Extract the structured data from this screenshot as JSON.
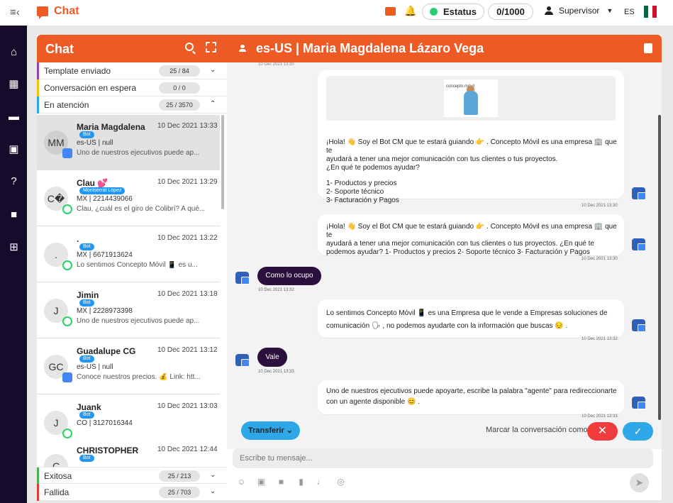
{
  "topbar": {
    "title": "Chat",
    "status_label": "Estatus",
    "counter": "0/1000",
    "user": "Supervisor",
    "lang": "ES",
    "icons": [
      "menu-collapse-icon",
      "chat-icon",
      "bell-icon",
      "user-icon",
      "mexico-flag-icon"
    ]
  },
  "sidebar": {
    "icons": [
      "home-icon",
      "table-icon",
      "chat-icon",
      "badge-icon",
      "help-icon",
      "video-icon",
      "add-box-icon"
    ]
  },
  "list": {
    "title": "Chat",
    "categories": [
      {
        "label": "Template enviado",
        "count": "25 / 84",
        "color": "#8e44ad"
      },
      {
        "label": "Conversación en espera",
        "count": "0 / 0",
        "color": "#f1c40f"
      },
      {
        "label": "En atención",
        "count": "25 / 3570",
        "color": "#2ea7e8"
      },
      {
        "label": "Exitosa",
        "count": "25 / 213",
        "color": "#4caf50"
      },
      {
        "label": "Fallida",
        "count": "25 / 703",
        "color": "#e53935"
      }
    ],
    "conversations": [
      {
        "initials": "MM",
        "name": "Maria Magdalena ...",
        "time": "10 Dec 2021 13:33",
        "tag": "Bot",
        "sub": "es-US | null",
        "preview": "Uno de nuestros ejecutivos puede ap...",
        "channel": "gb"
      },
      {
        "initials": "C�",
        "name": "Clau 💕",
        "time": "10 Dec 2021 13:29",
        "tag": "Montserrat Lopez",
        "sub": "MX | 2214439066",
        "preview": "Clau, ¿cuál es el giro de Colibrí? A qué...",
        "channel": "wa"
      },
      {
        "initials": ".",
        "name": ".",
        "time": "10 Dec 2021 13:22",
        "tag": "Bot",
        "sub": "MX | 6671913624",
        "preview": "Lo sentimos Concepto Móvil 📱 es u...",
        "channel": "wa"
      },
      {
        "initials": "J",
        "name": "Jimin",
        "time": "10 Dec 2021 13:18",
        "tag": "Bot",
        "sub": "MX | 2228973398",
        "preview": "Uno de nuestros ejecutivos puede ap...",
        "channel": "wa"
      },
      {
        "initials": "GC",
        "name": "Guadalupe CG",
        "time": "10 Dec 2021 13:12",
        "tag": "Bot",
        "sub": "es-US | null",
        "preview": "Conoce nuestros precios. 💰 Link: htt...",
        "channel": "gb"
      },
      {
        "initials": "J",
        "name": "Juank",
        "time": "10 Dec 2021 13:03",
        "tag": "Bot",
        "sub": "CO | 3127016344",
        "preview": "",
        "channel": "wa"
      },
      {
        "initials": "C",
        "name": "CHRISTOPHER",
        "time": "10 Dec 2021 12:44",
        "tag": "Bot",
        "sub": "",
        "preview": "",
        "channel": ""
      }
    ]
  },
  "conversation": {
    "title": "es-US | Maria Magdalena Lázaro Vega",
    "top_ts": "10 Dec 2021 13:30",
    "promo_logo": "concepto móvil",
    "msg1": {
      "l1": "¡Hola! 👋 Soy el Bot CM que te estará guiando 👉 . Concepto Móvil es una empresa 🏢 que te",
      "l2": "ayudará a tener una mejor comunicación con tus clientes o tus proyectos.",
      "l3": "¿En qué te podemos ayudar?",
      "l4": "1- Productos y precios",
      "l5": "2- Soporte técnico",
      "l6": "3- Facturación y Pagos",
      "ts": "10 Dec 2021 13:30"
    },
    "msg2": {
      "l1": "¡Hola! 👋 Soy el Bot CM que te estará guiando 👉 . Concepto Móvil es una empresa 🏢 que te",
      "l2": "ayudará a tener una mejor comunicación con tus clientes o tus proyectos. ¿En qué te",
      "l3": "podemos ayudar? 1- Productos y precios 2- Soporte técnico 3- Facturación y Pagos",
      "ts": "10 Dec 2021 13:30"
    },
    "user1": {
      "text": "Como lo ocupo",
      "ts": "10 Dec 2021 13:32"
    },
    "msg3": {
      "l1": "Lo sentimos Concepto Móvil 📱 es una Empresa que le vende a Empresas soluciones de",
      "l2": "comunicación 🗣 , no podemos ayudarte con la información que buscas 😔 .",
      "ts": "10 Dec 2021 13:32"
    },
    "user2": {
      "text": "Vale",
      "ts": "10 Dec 2021 13:33"
    },
    "msg4": {
      "l1": "Uno de nuestros ejecutivos puede apoyarte, escribe la palabra \"agente\" para redireccionarte",
      "l2": "con un agente disponible 😊 .",
      "ts": "10 Dec 2021 13:33"
    },
    "transfer_label": "Transferir",
    "mark_label": "Marcar la conversación como",
    "reject_symbol": "✕",
    "accept_symbol": "✓",
    "input_placeholder": "Escribe tu mensaje...",
    "tools": [
      "emoji-icon",
      "image-icon",
      "video-icon",
      "file-icon",
      "music-icon",
      "location-icon",
      "send-icon"
    ]
  },
  "colors": {
    "accent": "#ee5a24",
    "sidebar": "#170b2c",
    "blue": "#2ea7e8",
    "danger": "#f03c3c",
    "user_bubble": "#2b0f3c"
  }
}
